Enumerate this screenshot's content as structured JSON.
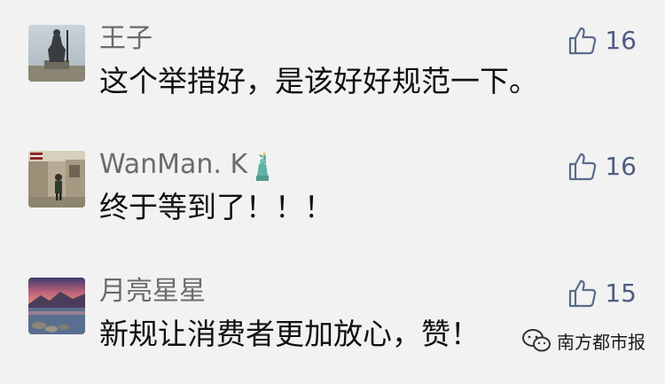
{
  "comments": [
    {
      "username": "王子",
      "content": "这个举措好，是该好好规范一下。",
      "likes": "16",
      "avatar_icon": "statue-avatar"
    },
    {
      "username": "WanMan. K",
      "username_emoji": "statue-of-liberty-emoji",
      "content": "终于等到了！！！",
      "likes": "16",
      "avatar_icon": "street-photo-avatar"
    },
    {
      "username": "月亮星星",
      "content": "新规让消费者更加放心，赞！",
      "likes": "15",
      "avatar_icon": "lake-sunset-avatar"
    }
  ],
  "watermark": {
    "label": "南方都市报",
    "icon": "wechat-official-account-icon"
  },
  "colors": {
    "background": "#f2f2f2",
    "username": "#6b6b6b",
    "content": "#111111",
    "like": "#4e5d80"
  }
}
